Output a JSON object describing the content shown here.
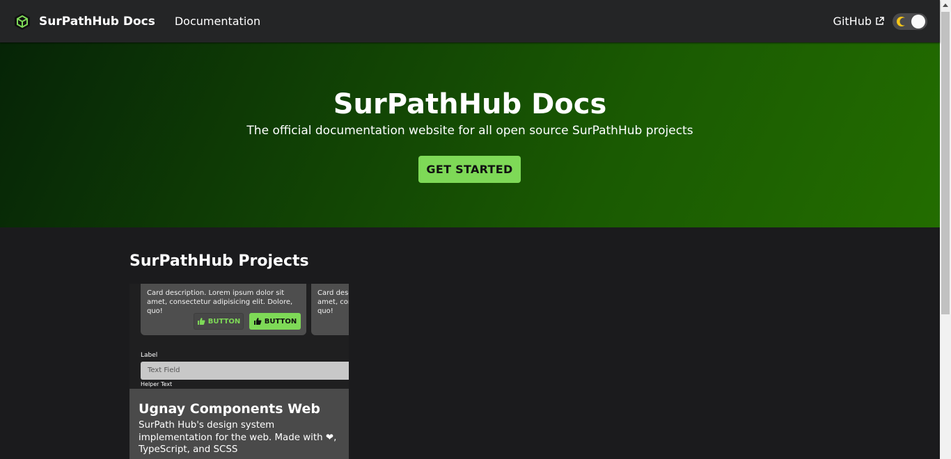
{
  "navbar": {
    "brand_title": "SurPathHub Docs",
    "links": [
      {
        "label": "Documentation"
      }
    ],
    "github_label": "GitHub",
    "theme_toggle_state": "dark"
  },
  "hero": {
    "title": "SurPathHub Docs",
    "subtitle": "The official documentation website for all open source SurPathHub projects",
    "cta_label": "GET STARTED"
  },
  "projects": {
    "heading": "SurPathHub Projects",
    "cards": [
      {
        "preview": {
          "card_desc_1": "Card description. Lorem ipsum dolor sit amet, consectetur adipisicing elit. Dolore, quo!",
          "card_desc_2": "Card description. Lorem ipsum dolor sit amet, consectetur adipisicing elit. Dolore, quo!",
          "button_outline": "BUTTON",
          "button_filled": "BUTTON",
          "field_label": "Label",
          "field_placeholder": "Text Field",
          "helper_text": "Helper Text"
        },
        "title": "Ugnay Components Web",
        "description": "SurPath Hub's design system implementation for the web. Made with ❤, TypeScript, and SCSS"
      }
    ]
  },
  "colors": {
    "accent": "#7ed957",
    "navbar_bg": "#242526",
    "page_bg": "#1b1b1d",
    "hero_gradient_start": "#062406",
    "hero_gradient_end": "#236d00"
  }
}
